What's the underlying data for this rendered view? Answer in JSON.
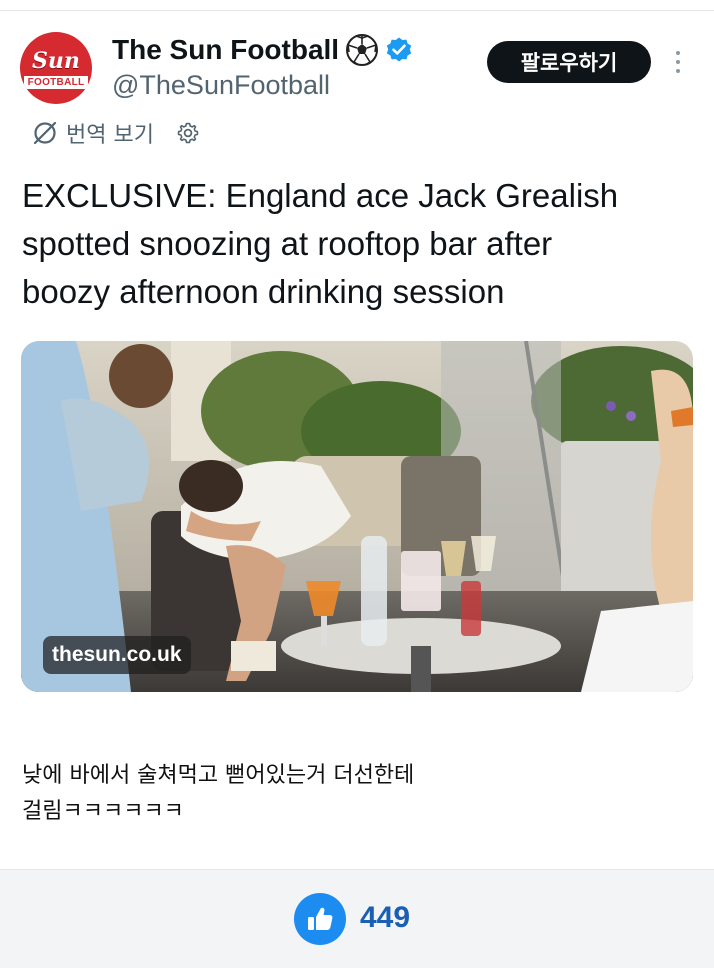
{
  "account": {
    "display_name": "The Sun Football",
    "handle": "@TheSunFootball",
    "avatar_logo_top": "Sun",
    "avatar_logo_bottom": "FOOTBALL",
    "name_emoji": "soccer-ball-icon",
    "verified_icon": "verified-badge-icon",
    "verified_color": "#1d9bf0"
  },
  "header": {
    "follow_label": "팔로우하기",
    "more_icon": "more-vertical-icon"
  },
  "translate": {
    "label": "번역 보기",
    "icon": "translate-slash-icon",
    "settings_icon": "gear-icon"
  },
  "tweet": {
    "lines": [
      "EXCLUSIVE: England ace Jack Grealish",
      "spotted snoozing at rooftop bar after",
      "boozy afternoon drinking session"
    ]
  },
  "media": {
    "source_label": "thesun.co.uk"
  },
  "comment": {
    "lines": [
      "낮에 바에서 술쳐먹고 뻗어있는거 더선한테",
      "걸림ㅋㅋㅋㅋㅋㅋ"
    ]
  },
  "footer": {
    "like_icon": "thumbs-up-icon",
    "like_count": "449",
    "like_color": "#1d8cf0"
  }
}
